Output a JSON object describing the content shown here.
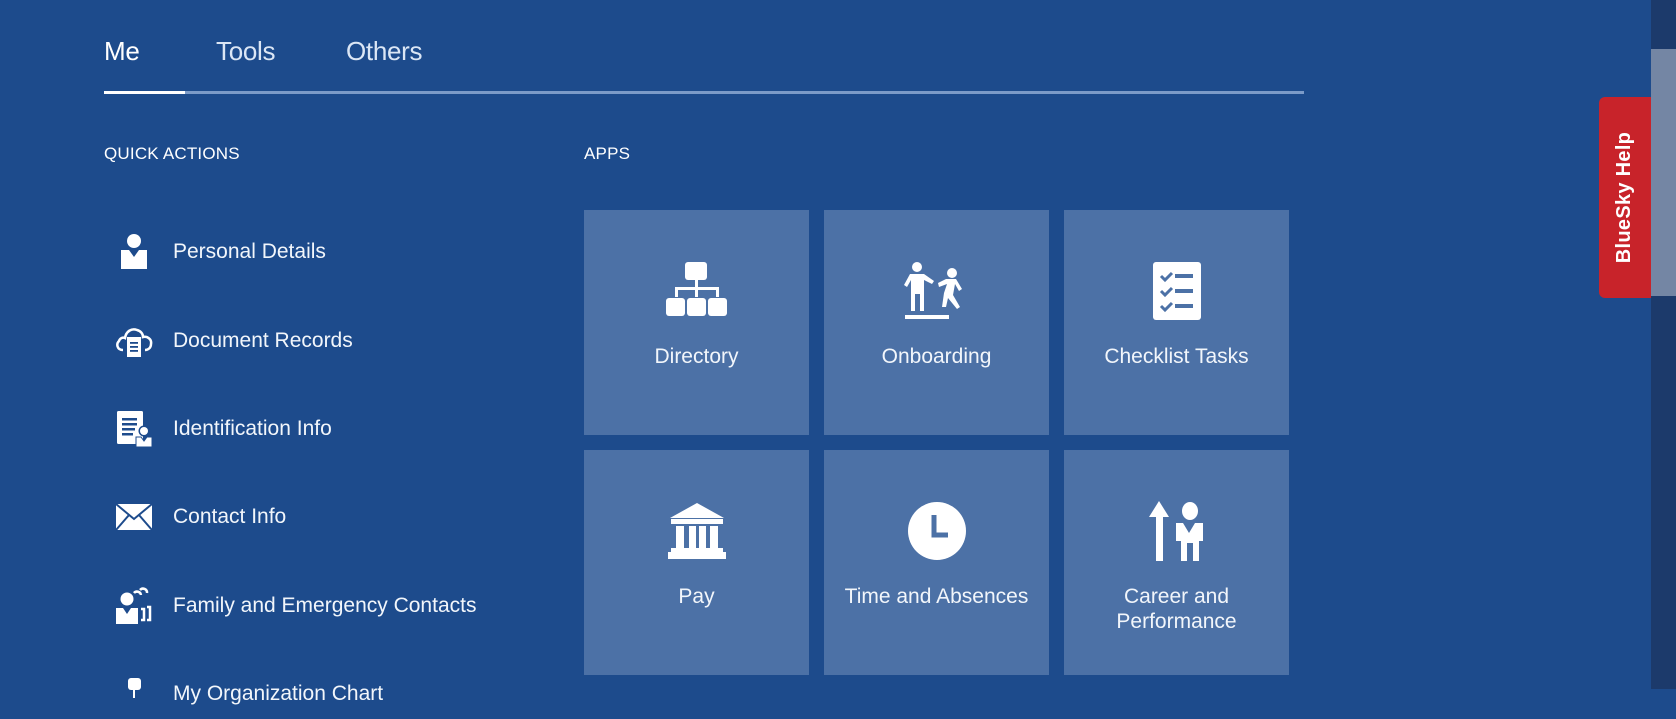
{
  "tabs": [
    {
      "label": "Me",
      "active": true
    },
    {
      "label": "Tools",
      "active": false
    },
    {
      "label": "Others",
      "active": false
    }
  ],
  "quick_actions": {
    "title": "QUICK ACTIONS",
    "items": [
      {
        "label": "Personal Details",
        "icon": "person-icon"
      },
      {
        "label": "Document Records",
        "icon": "cloud-document-icon"
      },
      {
        "label": "Identification Info",
        "icon": "id-document-icon"
      },
      {
        "label": "Contact Info",
        "icon": "envelope-icon"
      },
      {
        "label": "Family and Emergency Contacts",
        "icon": "family-contacts-icon"
      },
      {
        "label": "My Organization Chart",
        "icon": "org-chart-person-icon"
      }
    ]
  },
  "apps": {
    "title": "APPS",
    "tiles": [
      {
        "label": "Directory",
        "icon": "hierarchy-icon"
      },
      {
        "label": "Onboarding",
        "icon": "onboarding-people-icon"
      },
      {
        "label": "Checklist Tasks",
        "icon": "checklist-icon"
      },
      {
        "label": "Pay",
        "icon": "bank-icon"
      },
      {
        "label": "Time and Absences",
        "icon": "clock-icon"
      },
      {
        "label": "Career and Performance",
        "icon": "career-growth-icon"
      }
    ]
  },
  "help_tab": {
    "label": "BlueSky Help",
    "color": "#c8232a"
  },
  "colors": {
    "background": "#1d4b8c",
    "tile": "#4c71a6",
    "scroll_track": "#1c3a6b",
    "scroll_thumb": "#7486a4"
  }
}
